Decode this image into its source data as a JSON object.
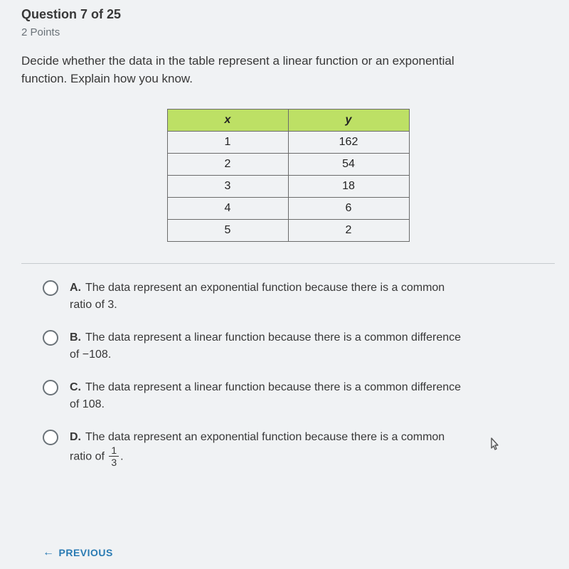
{
  "header": {
    "question_label": "Question 7 of 25",
    "points": "2 Points"
  },
  "question_text": "Decide whether the data in the table represent a linear function or an exponential function. Explain how you know.",
  "table": {
    "headers": {
      "x": "x",
      "y": "y"
    },
    "rows": [
      {
        "x": "1",
        "y": "162"
      },
      {
        "x": "2",
        "y": "54"
      },
      {
        "x": "3",
        "y": "18"
      },
      {
        "x": "4",
        "y": "6"
      },
      {
        "x": "5",
        "y": "2"
      }
    ]
  },
  "choices": {
    "a": {
      "letter": "A.",
      "text": "The data represent an exponential function because there is a common ratio of 3."
    },
    "b": {
      "letter": "B.",
      "text": "The data represent a linear function because there is a common difference of −108."
    },
    "c": {
      "letter": "C.",
      "text": "The data represent a linear function because there is a common difference of 108."
    },
    "d": {
      "letter": "D.",
      "text_before": "The data represent an exponential function because there is a common ratio of ",
      "fraction": {
        "num": "1",
        "den": "3"
      },
      "text_after": "."
    }
  },
  "nav": {
    "previous": "PREVIOUS"
  }
}
